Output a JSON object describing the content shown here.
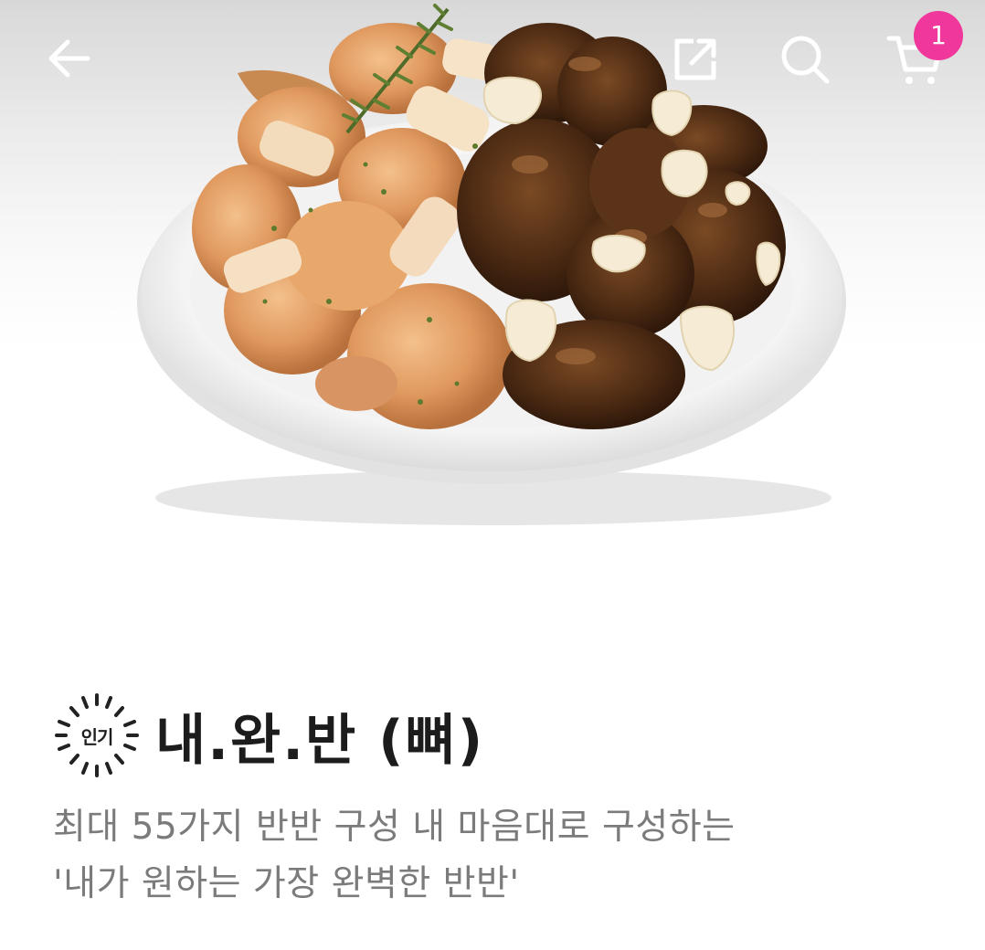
{
  "header": {
    "back_icon": "arrow-left-icon",
    "share_icon": "share-icon",
    "search_icon": "search-icon",
    "cart_icon": "cart-icon",
    "cart_count": "1",
    "badge_color": "#f0379b"
  },
  "hero": {
    "image": "half-and-half-chicken-plate"
  },
  "product": {
    "badge_label": "인기",
    "title": "내.완.반 (뼈)",
    "description_line1": "최대 55가지 반반 구성 내 마음대로 구성하는",
    "description_line2": "'내가 원하는 가장 완벽한 반반'"
  }
}
